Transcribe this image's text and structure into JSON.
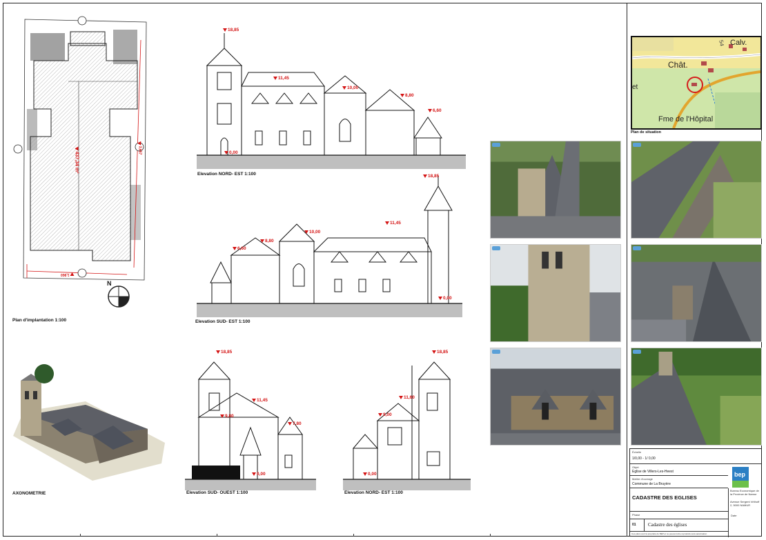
{
  "captions": {
    "plan": "Plan d'implantation 1:100",
    "axo": "AXONOMETRIE",
    "ne": "Elevation NORD- EST 1:100",
    "se": "Elevation SUD- EST 1:100",
    "so": "Elevation SUD- OUEST 1:100",
    "ne2": "Elevation NORD- EST 1:100",
    "situation": "Plan de situation"
  },
  "plan": {
    "area": "437,34 m²",
    "dim_right": "3,657",
    "dim_bottom": "1,960",
    "north": "N"
  },
  "map": {
    "calv": "Calv.",
    "chat": "Chât.",
    "fme": "Fme de l'Hôpital",
    "et": "et",
    "tag": "54"
  },
  "levels": {
    "ne": [
      "18,85",
      "11,45",
      "10,00",
      "8,80",
      "6,60",
      "0,00"
    ],
    "se": [
      "18,85",
      "11,45",
      "10,00",
      "8,80",
      "6,60",
      "0,00"
    ],
    "so": [
      "18,85",
      "11,45",
      "9,80",
      "7,80",
      "0,00"
    ],
    "ne2": [
      "18,85",
      "11,60",
      "9,00",
      "0,00"
    ]
  },
  "titleblock": {
    "echelle_label": "Échelle",
    "echelle": "1/0,00 - 1/ 0,00",
    "objet_label": "Objet",
    "objet": "Eglise de Villers-Les-Heest",
    "commune_label": "Maître d'ouvrage",
    "commune": "Commune de La Bruyère",
    "title": "CADASTRE DES EGLISES",
    "logo": "bep",
    "org": "Bureau Economique de la Province de Namur",
    "addr": "Avenue Sergent Vrithoff 2, 5000 NAMUR",
    "phase_label": "Phase",
    "num": "01",
    "doc": "Cadastre des églises",
    "date_label": "Date",
    "footer": "Ces plans sont la propriété du BEP et ne peuvent être reproduits sans autorisation"
  },
  "colors": {
    "level_red": "#d41414",
    "map_green": "#cfe6a9",
    "map_yellow": "#f2e79a"
  }
}
